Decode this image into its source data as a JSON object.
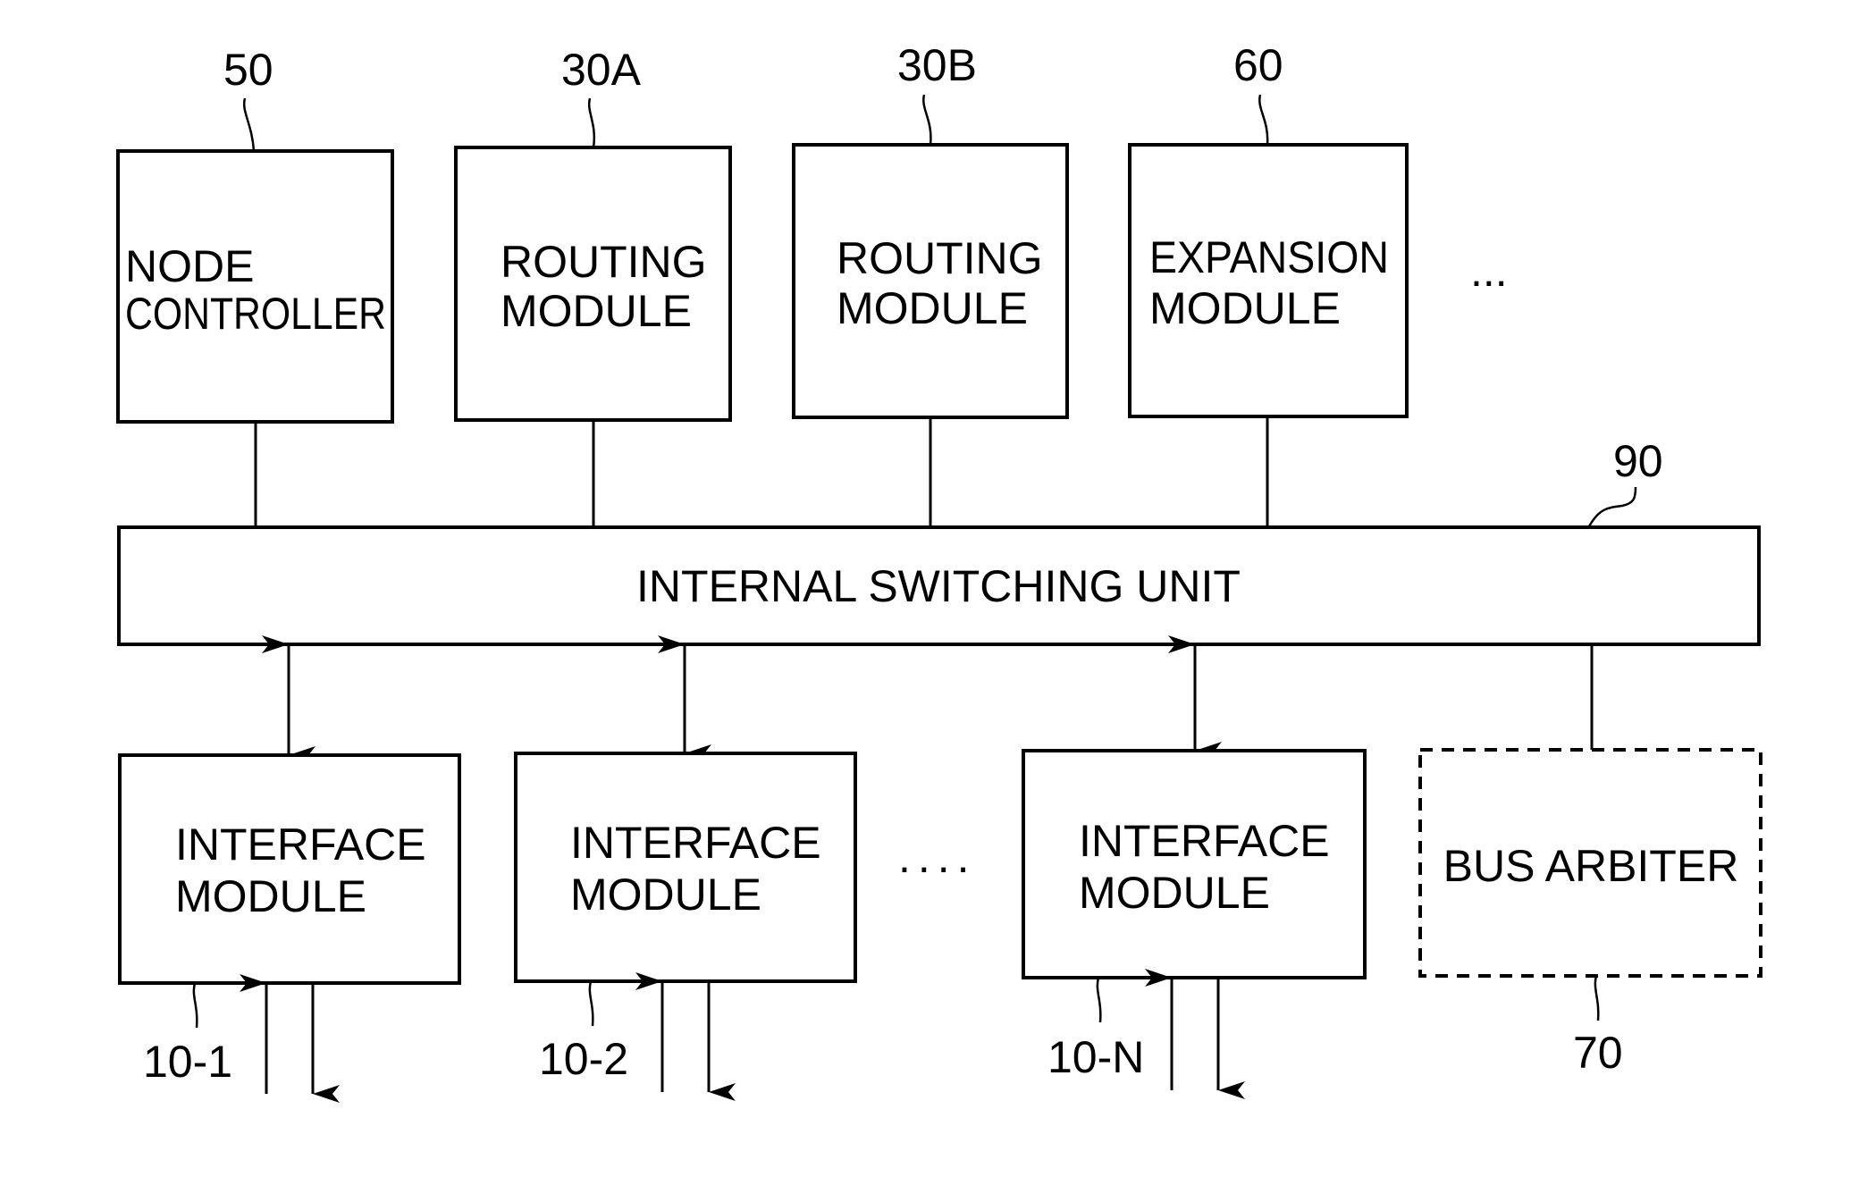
{
  "diagram": {
    "top_modules": [
      {
        "ref": "50",
        "line1": "NODE",
        "line2": "CONTROLLER"
      },
      {
        "ref": "30A",
        "line1": "ROUTING",
        "line2": "MODULE"
      },
      {
        "ref": "30B",
        "line1": "ROUTING",
        "line2": "MODULE"
      },
      {
        "ref": "60",
        "line1": "EXPANSION",
        "line2": "MODULE"
      }
    ],
    "top_ellipsis": "...",
    "switching_unit": {
      "ref": "90",
      "label": "INTERNAL SWITCHING UNIT"
    },
    "interface_modules": [
      {
        "ref": "10-1",
        "line1": "INTERFACE",
        "line2": "MODULE"
      },
      {
        "ref": "10-2",
        "line1": "INTERFACE",
        "line2": "MODULE"
      },
      {
        "ref": "10-N",
        "line1": "INTERFACE",
        "line2": "MODULE"
      }
    ],
    "bottom_ellipsis": "....",
    "bus_arbiter": {
      "ref": "70",
      "label": "BUS ARBITER"
    }
  }
}
